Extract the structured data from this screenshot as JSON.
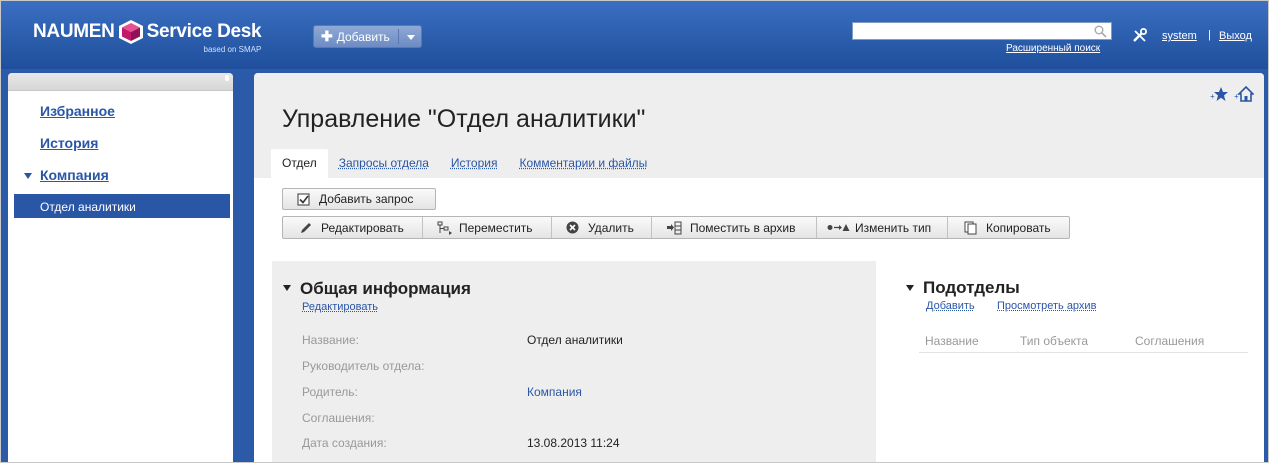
{
  "header": {
    "logo_main_left": "NAUMEN",
    "logo_main_right": "Service Desk",
    "logo_sub": "based on SMAP",
    "add_button": "Добавить",
    "search_value": "",
    "advanced_search": "Расширенный поиск",
    "user": "system",
    "separator": "|",
    "logout": "Выход"
  },
  "sidebar": {
    "items": [
      {
        "label": "Избранное"
      },
      {
        "label": "История"
      },
      {
        "label": "Компания"
      }
    ],
    "active_item": "Отдел аналитики"
  },
  "main": {
    "title": "Управление \"Отдел аналитики\"",
    "tabs": [
      {
        "label": "Отдел",
        "active": true
      },
      {
        "label": "Запросы отдела"
      },
      {
        "label": "История"
      },
      {
        "label": "Комментарии и файлы"
      }
    ],
    "add_request": "Добавить запрос",
    "actions": [
      {
        "label": "Редактировать",
        "icon": "pencil-icon"
      },
      {
        "label": "Переместить",
        "icon": "move-icon"
      },
      {
        "label": "Удалить",
        "icon": "delete-icon"
      },
      {
        "label": "Поместить в архив",
        "icon": "archive-icon"
      },
      {
        "label": "Изменить тип",
        "icon": "change-type-icon"
      },
      {
        "label": "Копировать",
        "icon": "copy-icon"
      }
    ],
    "general": {
      "title": "Общая информация",
      "edit_link": "Редактировать",
      "fields": [
        {
          "label": "Название:",
          "value": "Отдел аналитики"
        },
        {
          "label": "Руководитель отдела:",
          "value": ""
        },
        {
          "label": "Родитель:",
          "value": "Компания"
        },
        {
          "label": "Соглашения:",
          "value": ""
        },
        {
          "label": "Дата создания:",
          "value": "13.08.2013 11:24"
        }
      ]
    },
    "subdivisions": {
      "title": "Подотделы",
      "add_link": "Добавить",
      "archive_link": "Просмотреть архив",
      "columns": [
        "Название",
        "Тип объекта",
        "Соглашения"
      ]
    }
  },
  "colors": {
    "header_blue": "#2a5aa8",
    "link_blue": "#2a56a6",
    "panel_gray": "#eeeeee"
  }
}
